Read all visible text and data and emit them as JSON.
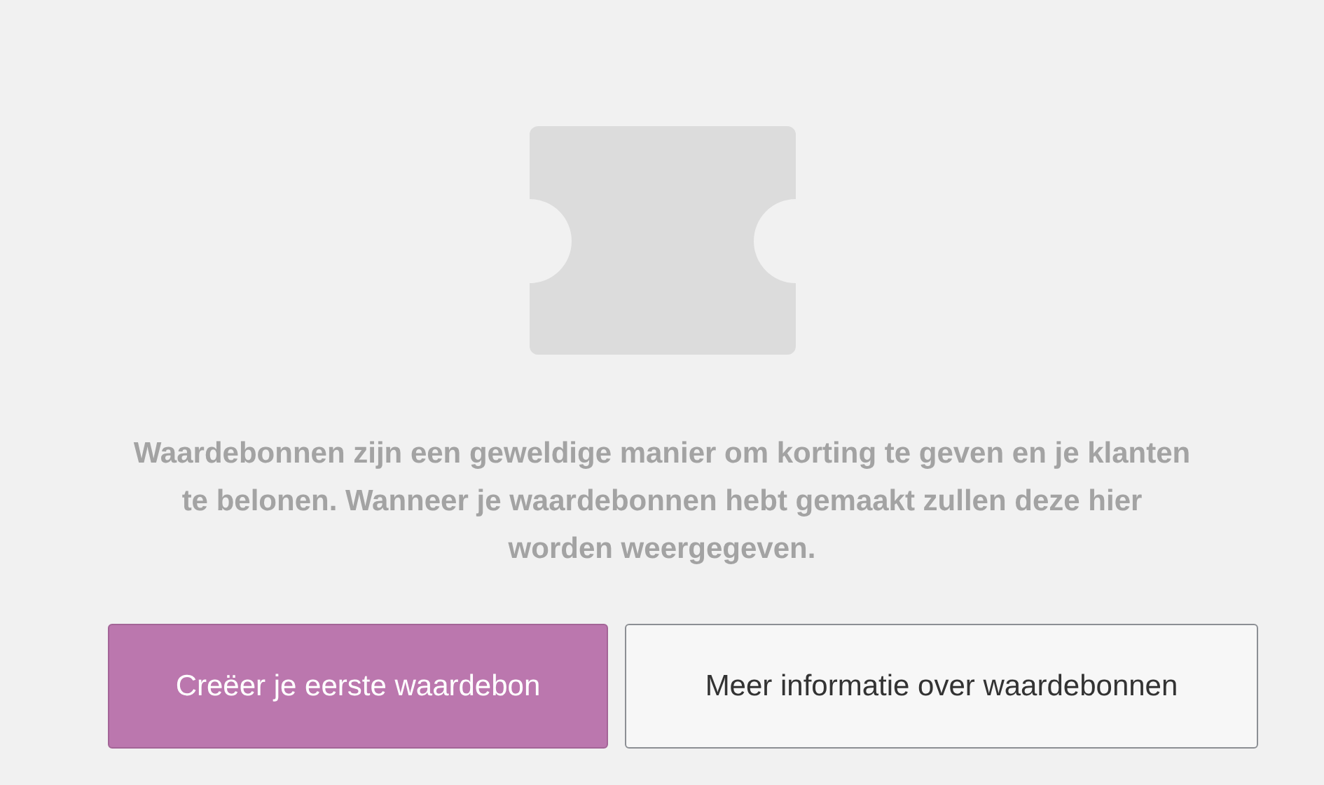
{
  "message": "Waardebonnen zijn een geweldige manier om korting te geven en je klanten te belonen. Wanneer je waardebonnen hebt gemaakt zullen deze hier worden weergegeven.",
  "buttons": [
    {
      "label": "Creëer je eerste waardebon",
      "kind": "primary"
    },
    {
      "label": "Meer informatie over waardebonnen",
      "kind": "secondary"
    }
  ]
}
